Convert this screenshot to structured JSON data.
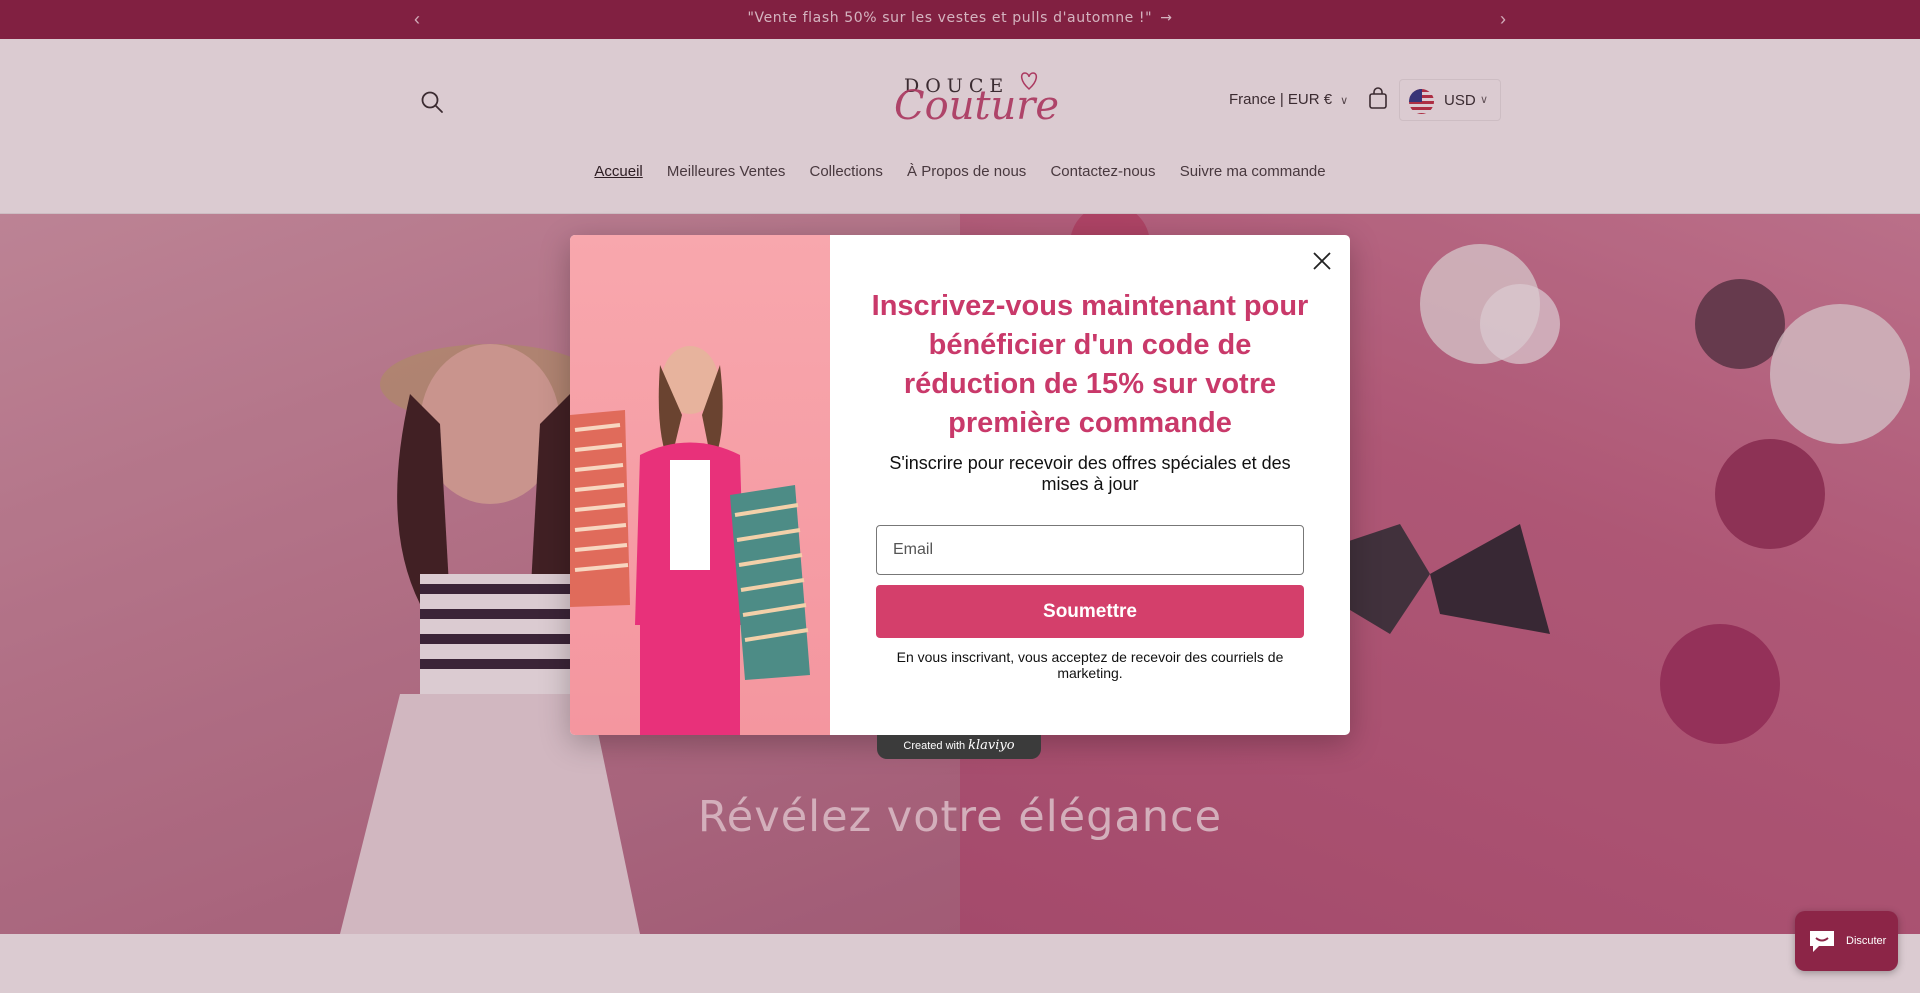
{
  "announcement": {
    "message": "\"Vente flash 50% sur les vestes et pulls d'automne !\"",
    "go_arrow": "→",
    "prev_arrow": "‹",
    "next_arrow": "›"
  },
  "header": {
    "logo": {
      "line1": "DOUCE",
      "line2": "Couture"
    },
    "locale": "France | EUR €",
    "currency": "USD"
  },
  "nav": {
    "items": [
      "Accueil",
      "Meilleures Ventes",
      "Collections",
      "À Propos de nous",
      "Contactez-nous",
      "Suivre ma commande"
    ],
    "active_index": 0
  },
  "hero": {
    "headline": "Révélez votre élégance"
  },
  "popup": {
    "title": "Inscrivez-vous maintenant pour bénéficier d'un code de réduction de 15% sur votre première commande",
    "subtitle": "S'inscrire pour recevoir des offres spéciales et des mises à jour",
    "email_placeholder": "Email",
    "email_value": "",
    "submit_label": "Soumettre",
    "legal": "En vous inscrivant, vous acceptez de recevoir des courriels de marketing.",
    "badge_prefix": "Created with",
    "badge_brand": "klaviyo"
  },
  "chat": {
    "label": "Discuter"
  },
  "colors": {
    "brand_dark": "#8c2547",
    "accent_pink": "#c9396a",
    "button_pink": "#d43f6b"
  },
  "icons": [
    "search-icon",
    "cart-icon",
    "flag-icon",
    "chevron-down-icon",
    "close-icon",
    "chat-icon",
    "arrow-left-icon",
    "arrow-right-icon"
  ]
}
